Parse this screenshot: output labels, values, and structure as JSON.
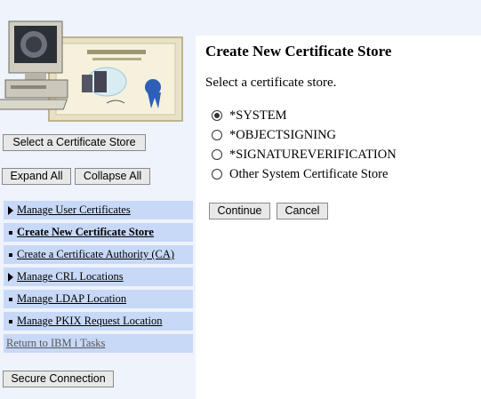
{
  "sidebar": {
    "select_store_button": "Select a Certificate Store",
    "expand_all_button": "Expand All",
    "collapse_all_button": "Collapse All",
    "nav": [
      {
        "label": "Manage User Certificates",
        "marker": "triangle"
      },
      {
        "label": "Create New Certificate Store",
        "marker": "square",
        "current": true
      },
      {
        "label": "Create a Certificate Authority (CA)",
        "marker": "square"
      },
      {
        "label": "Manage CRL Locations",
        "marker": "triangle"
      },
      {
        "label": "Manage LDAP Location",
        "marker": "square"
      },
      {
        "label": "Manage PKIX Request Location",
        "marker": "square"
      },
      {
        "label": "Return to IBM i Tasks",
        "marker": "none"
      }
    ],
    "secure_connection_button": "Secure Connection"
  },
  "main": {
    "title": "Create New Certificate Store",
    "prompt": "Select a certificate store.",
    "options": [
      {
        "label": "*SYSTEM",
        "checked": true
      },
      {
        "label": "*OBJECTSIGNING",
        "checked": false
      },
      {
        "label": "*SIGNATUREVERIFICATION",
        "checked": false
      },
      {
        "label": "Other System Certificate Store",
        "checked": false
      }
    ],
    "continue_button": "Continue",
    "cancel_button": "Cancel"
  },
  "colors": {
    "sidebar_background": "#eef3fc",
    "nav_item_background": "#c8d9f7",
    "button_background": "#e8e8e8"
  }
}
